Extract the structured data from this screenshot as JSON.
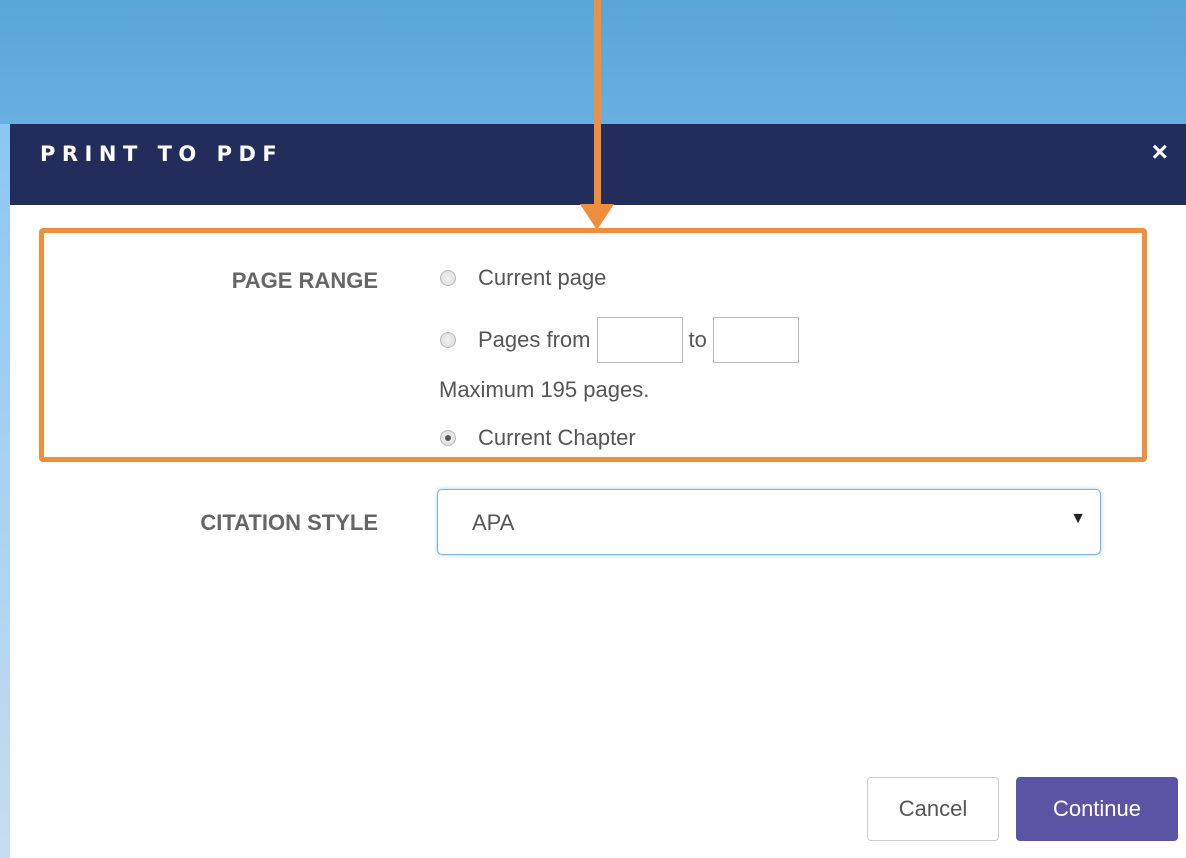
{
  "dialog": {
    "title": "PRINT TO PDF",
    "close_icon": "×"
  },
  "page_range": {
    "label": "PAGE RANGE",
    "options": [
      {
        "label": "Current page",
        "checked": false
      },
      {
        "label": "Pages from",
        "checked": false
      },
      {
        "label": "Current Chapter",
        "checked": true
      }
    ],
    "from_value": "",
    "to_label": "to",
    "to_value": "",
    "max_note": "Maximum 195 pages."
  },
  "citation": {
    "label": "CITATION STYLE",
    "selected": "APA",
    "caret": "▼"
  },
  "buttons": {
    "cancel": "Cancel",
    "continue": "Continue"
  },
  "colors": {
    "header_bg": "#222d5c",
    "accent": "#5b54a4",
    "highlight": "#ef8f3d"
  }
}
